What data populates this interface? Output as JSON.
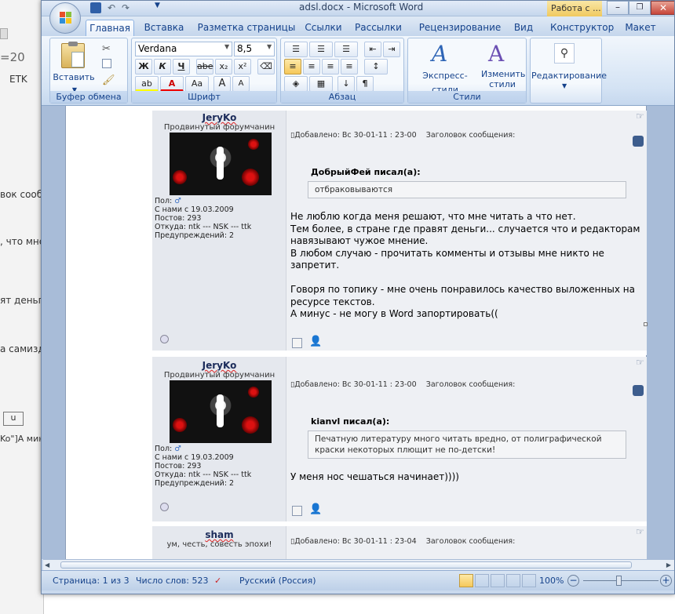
{
  "background_window": {
    "fragments": [
      "=20",
      "ETK",
      "вок сообщ",
      ", что мне",
      "ят деньги",
      "а самизд",
      "u",
      "Ko\"]А мин"
    ]
  },
  "word": {
    "title": "adsl.docx - Microsoft Word",
    "context_tab": "Работа с ...",
    "tabs": [
      "Главная",
      "Вставка",
      "Разметка страницы",
      "Ссылки",
      "Рассылки",
      "Рецензирование",
      "Вид",
      "Конструктор",
      "Макет"
    ],
    "ribbon": {
      "clipboard": {
        "label": "Буфер обмена",
        "paste": "Вставить"
      },
      "font": {
        "label": "Шрифт",
        "font_name": "Verdana",
        "font_size": "8,5",
        "bold": "Ж",
        "italic": "К",
        "underline": "Ч",
        "strike": "abe",
        "sub": "x₂",
        "sup": "x²",
        "highlight": "ab",
        "color": "A",
        "case": "Aa",
        "grow": "A",
        "shrink": "A"
      },
      "paragraph": {
        "label": "Абзац"
      },
      "styles": {
        "label": "Стили",
        "express": "Экспресс-стили",
        "change": "Изменить стили"
      },
      "editing": {
        "label": "Редактирование"
      }
    },
    "posts": [
      {
        "username": "JeryKo",
        "status": "Продвинутый форумчанин",
        "gender": "Пол:",
        "joined": "С нами с 19.03.2009",
        "posts": "Постов: 293",
        "location": "Откуда: ntk --- NSK --- ttk",
        "warnings": "Предупреждений: 2",
        "added": "Добавлено: Вс 30-01-11 : 23-00",
        "subject": "Заголовок сообщения:",
        "quote_author": "ДобрыйФей писал(а):",
        "quote": [
          "отбраковываются"
        ],
        "body": [
          "Не люблю когда меня решают, что мне читать а что нет.",
          "Тем более, в стране где правят деньги... случается что и редакторам",
          "навязывают чужое мнение.",
          "В любом случаю - прочитать комменты и отзывы мне никто не",
          "запретит.",
          "",
          "Говоря по топику - мне очень понравилось качество выложенных на",
          "ресурсе текстов.",
          "А минус - не могу в Word запортировать(("
        ]
      },
      {
        "username": "JeryKo",
        "status": "Продвинутый форумчанин",
        "gender": "Пол:",
        "joined": "С нами с 19.03.2009",
        "posts": "Постов: 293",
        "location": "Откуда: ntk --- NSK --- ttk",
        "warnings": "Предупреждений: 2",
        "added": "Добавлено: Вс 30-01-11 : 23-00",
        "subject": "Заголовок сообщения:",
        "quote_author": "kianvl писал(а):",
        "quote": [
          "Печатную литературу много читать вредно, от полиграфической",
          "краски некоторых плющит не по-детски!"
        ],
        "body": [
          "У меня нос чешаться начинает))))"
        ]
      },
      {
        "username": "sham",
        "status": "ум, честь, совесть эпохи!",
        "added": "Добавлено: Вс 30-01-11 : 23-04",
        "subject": "Заголовок сообщения:"
      }
    ],
    "status_bar": {
      "page": "Страница: 1 из 3",
      "words": "Число слов: 523",
      "language": "Русский (Россия)",
      "zoom": "100%"
    }
  }
}
